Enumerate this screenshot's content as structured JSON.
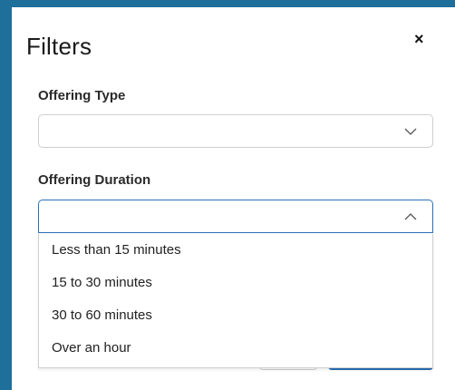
{
  "dialog": {
    "title": "Filters",
    "close_symbol": "×"
  },
  "offering_type": {
    "label": "Offering Type",
    "value": "",
    "icon": "chevron-down-icon"
  },
  "offering_duration": {
    "label": "Offering Duration",
    "value": "",
    "icon": "chevron-up-icon",
    "options": [
      "Less than 15 minutes",
      "15 to 30 minutes",
      "30 to 60 minutes",
      "Over an hour"
    ]
  },
  "colors": {
    "frame_border": "#1f6f9b",
    "focus_border": "#2a6fb5"
  }
}
